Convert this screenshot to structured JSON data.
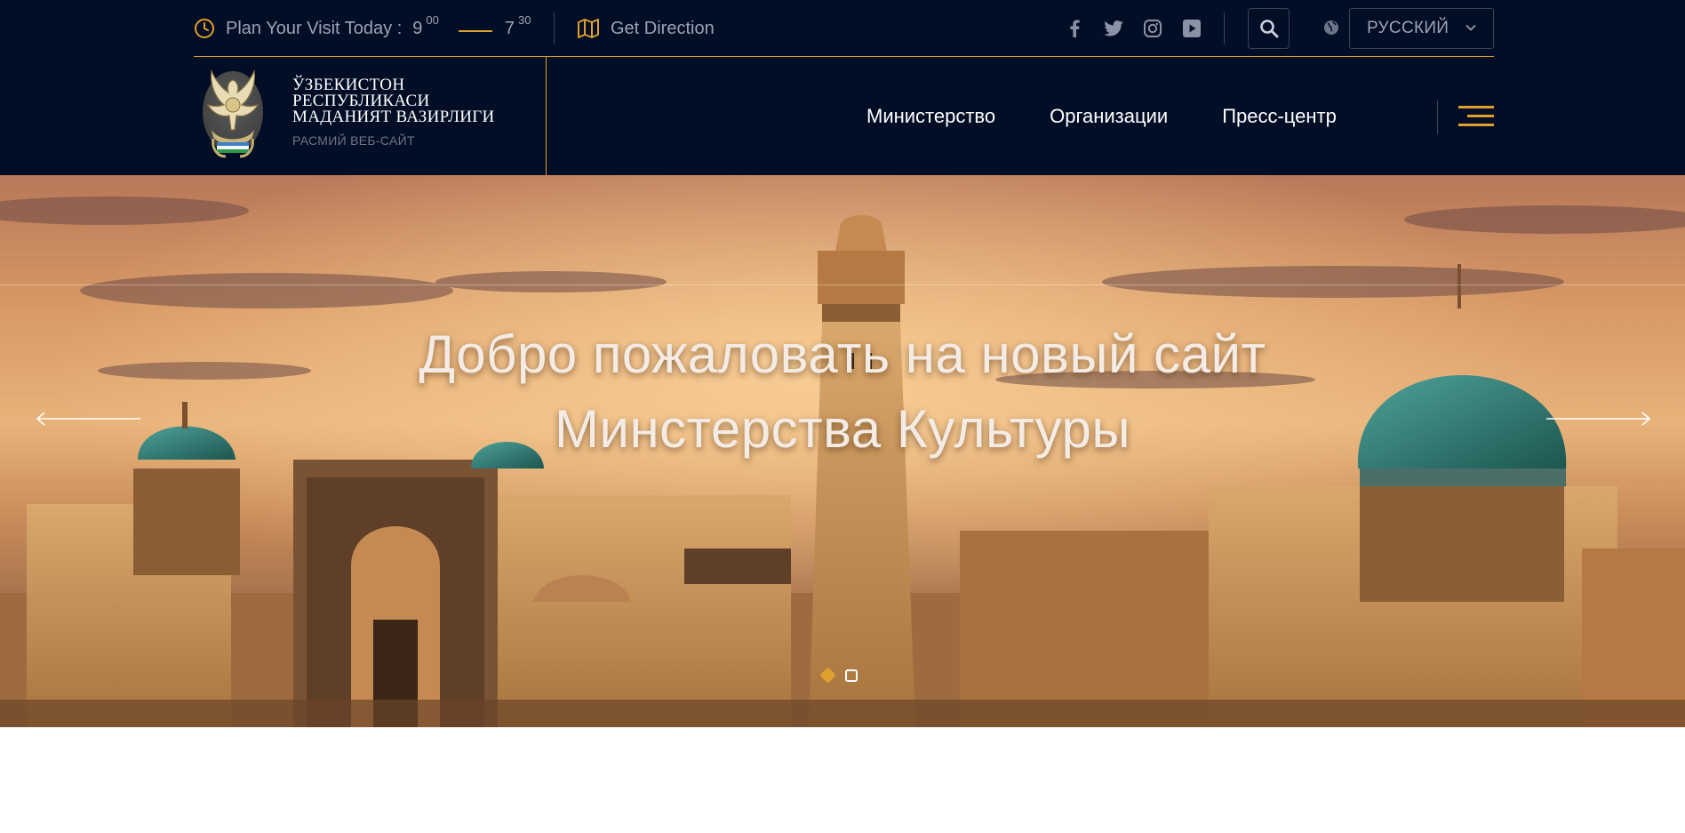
{
  "topbar": {
    "visit_label": "Plan Your Visit Today :",
    "open_hour": "9",
    "open_min": "00",
    "close_hour": "7",
    "close_min": "30",
    "direction_label": "Get Direction",
    "social": [
      "facebook-icon",
      "twitter-icon",
      "instagram-icon",
      "youtube-icon"
    ],
    "language": "РУССКИЙ"
  },
  "brand": {
    "title_line1": "ЎЗБЕКИСТОН",
    "title_line2": "РЕСПУБЛИКАСИ",
    "title_line3": "МАДАНИЯТ ВАЗИРЛИГИ",
    "subtitle": "РАСМИЙ ВЕБ-САЙТ"
  },
  "nav": {
    "items": [
      {
        "label": "Министерство"
      },
      {
        "label": "Организации"
      },
      {
        "label": "Пресс-центр"
      }
    ]
  },
  "hero": {
    "line1": "Добро пожаловать на новый сайт",
    "line2": "Минстерства Культуры",
    "slide_count": 2,
    "active_slide": 1
  },
  "colors": {
    "header_bg": "#020d26",
    "accent": "#e0a02e",
    "muted_text": "#9ba3b6"
  }
}
